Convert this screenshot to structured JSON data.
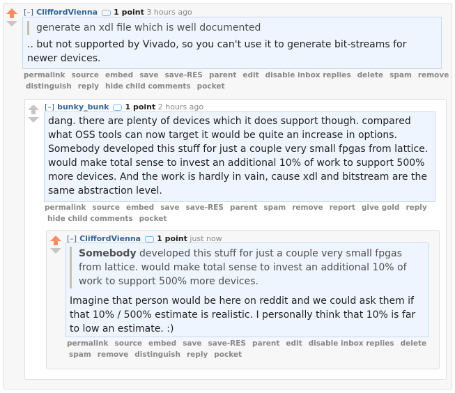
{
  "colors": {
    "upvote_active": "#ff8b60",
    "arrow_gray": "#c6c6c6",
    "author": "#336699",
    "link_gray": "#888888",
    "body_bg": "#eef5ff"
  },
  "comments": [
    {
      "toggle": "[–]",
      "author": "CliffordVienna",
      "flair_icon": "speech-bubble-icon",
      "score": "1 point",
      "time": "3 hours ago",
      "vote": "upvoted",
      "quote": "generate an xdl file which is well documented",
      "text": ".. but not supported by Vivado, so you can't use it to generate bit-streams for newer devices.",
      "buttons": [
        "permalink",
        "source",
        "embed",
        "save",
        "save-RES",
        "parent",
        "edit",
        "disable inbox replies",
        "delete",
        "spam",
        "remove",
        "distinguish",
        "reply",
        "hide child comments",
        "pocket"
      ]
    },
    {
      "toggle": "[–]",
      "author": "bunky_bunk",
      "flair_icon": "speech-bubble-icon",
      "score": "1 point",
      "time": "2 hours ago",
      "vote": "none",
      "text": "dang. there are plenty of devices which it does support though. compared what OSS tools can now target it would be quite an increase in options. Somebody developed this stuff for just a couple very small fpgas from lattice. would make total sense to invest an additional 10% of work to support 500% more devices. And the work is hardly in vain, cause xdl and bitstream are the same abstraction level.",
      "buttons": [
        "permalink",
        "source",
        "embed",
        "save",
        "save-RES",
        "parent",
        "spam",
        "remove",
        "report",
        "give gold",
        "reply",
        "hide child comments",
        "pocket"
      ]
    },
    {
      "toggle": "[–]",
      "author": "CliffordVienna",
      "flair_icon": "speech-bubble-icon",
      "score": "1 point",
      "time": "just now",
      "vote": "upvoted",
      "quote_bold": "Somebody",
      "quote_rest": " developed this stuff for just a couple very small fpgas from lattice. would make total sense to invest an additional 10% of work to support 500% more devices.",
      "text": "Imagine that person would be here on reddit and we could ask them if that 10% / 500% estimate is realistic. I personally think that 10% is far to low an estimate. :)",
      "buttons": [
        "permalink",
        "source",
        "embed",
        "save",
        "save-RES",
        "parent",
        "edit",
        "disable inbox replies",
        "delete",
        "spam",
        "remove",
        "distinguish",
        "reply",
        "pocket"
      ]
    }
  ]
}
